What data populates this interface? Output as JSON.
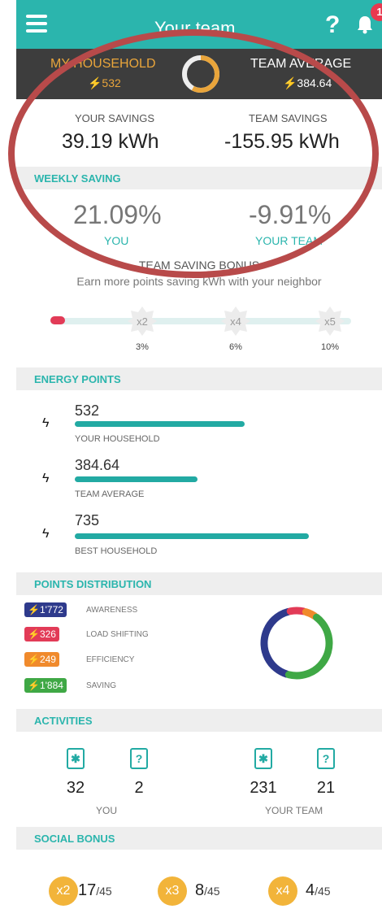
{
  "header": {
    "title": "Your team",
    "help_label": "?",
    "notification_count": "1"
  },
  "household_strip": {
    "my_label": "MY HOUSEHOLD",
    "my_value": "⚡532",
    "team_label": "TEAM AVERAGE",
    "team_value": "⚡384.64",
    "ring_share": 0.58
  },
  "savings": {
    "your_label": "YOUR SAVINGS",
    "your_value": "39.19 kWh",
    "team_label": "TEAM SAVINGS",
    "team_value": "-155.95 kWh"
  },
  "weekly_saving": {
    "header": "WEEKLY SAVING",
    "you_pct": "21.09%",
    "you_label": "YOU",
    "team_pct": "-9.91%",
    "team_label": "YOUR TEAM",
    "bonus_title": "TEAM SAVING BONUS",
    "bonus_sub": "Earn more points saving kWh with your neighbor",
    "bonus_levels": [
      {
        "label": "x2",
        "pct": "3%"
      },
      {
        "label": "x4",
        "pct": "6%"
      },
      {
        "label": "x5",
        "pct": "10%"
      }
    ]
  },
  "energy_points": {
    "header": "ENERGY POINTS",
    "rows": [
      {
        "value": "532",
        "label": "YOUR HOUSEHOLD",
        "fraction": 0.724
      },
      {
        "value": "384.64",
        "label": "TEAM AVERAGE",
        "fraction": 0.523
      },
      {
        "value": "735",
        "label": "BEST HOUSEHOLD",
        "fraction": 1.0
      }
    ]
  },
  "points_distribution": {
    "header": "POINTS DISTRIBUTION",
    "items": [
      {
        "value": "⚡1'772",
        "label": "AWARENESS",
        "color": "#2e3a8c"
      },
      {
        "value": "⚡326",
        "label": "LOAD SHIFTING",
        "color": "#e23b57"
      },
      {
        "value": "⚡249",
        "label": "EFFICIENCY",
        "color": "#f08a2c"
      },
      {
        "value": "⚡1'884",
        "label": "SAVING",
        "color": "#3fa845"
      }
    ],
    "donut_values": [
      1772,
      326,
      249,
      1884
    ]
  },
  "activities": {
    "header": "ACTIVITIES",
    "you_label": "YOU",
    "team_label": "YOUR TEAM",
    "you_a": "32",
    "you_b": "2",
    "team_a": "231",
    "team_b": "21",
    "icon_a": "✱",
    "icon_b": "?"
  },
  "social_bonus": {
    "header": "SOCIAL BONUS",
    "items": [
      {
        "mult": "x2",
        "value": "17",
        "total": "/45"
      },
      {
        "mult": "x3",
        "value": "8",
        "total": "/45"
      },
      {
        "mult": "x4",
        "value": "4",
        "total": "/45"
      }
    ]
  },
  "colors": {
    "accent": "#2bb5ad",
    "strip_bg": "#3d3d3d",
    "household_orange": "#e9a53b",
    "annotation_oval": "#b84a4a"
  }
}
